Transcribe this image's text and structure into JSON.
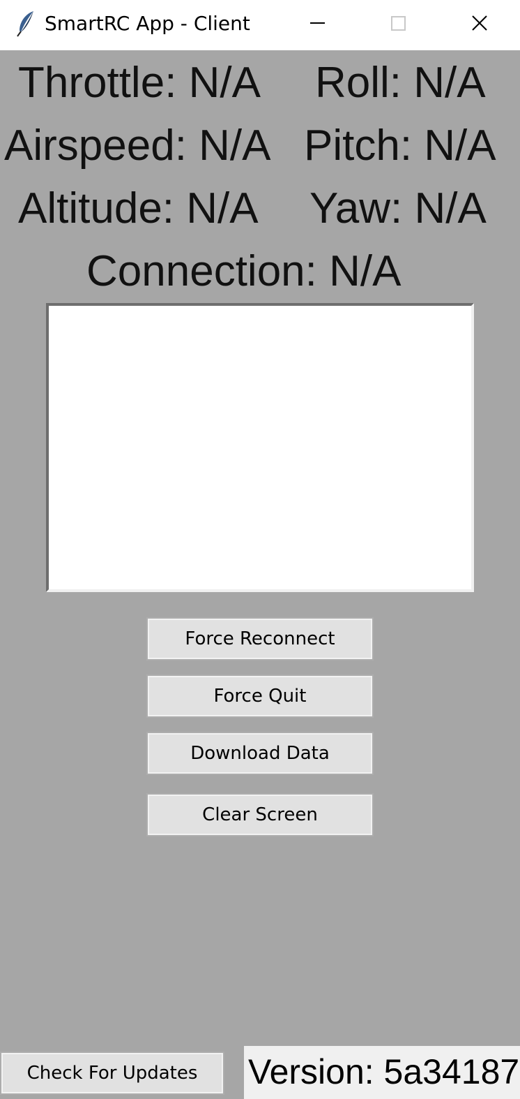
{
  "window": {
    "title": "SmartRC App - Client",
    "icon": "feather-icon"
  },
  "telemetry": {
    "throttle": "Throttle: N/A",
    "roll": "Roll: N/A",
    "airspeed": "Airspeed: N/A",
    "pitch": "Pitch: N/A",
    "altitude": "Altitude: N/A",
    "yaw": "Yaw: N/A",
    "connection": "Connection: N/A"
  },
  "console": {
    "text": ""
  },
  "buttons": {
    "force_reconnect": "Force Reconnect",
    "force_quit": "Force Quit",
    "download_data": "Download Data",
    "clear_screen": "Clear Screen",
    "check_updates": "Check For Updates"
  },
  "version": {
    "label": "Version: 5a34187"
  },
  "colors": {
    "background": "#a6a6a6",
    "titlebar": "#ffffff",
    "button_face": "#e1e1e1",
    "console_bg": "#ffffff"
  }
}
